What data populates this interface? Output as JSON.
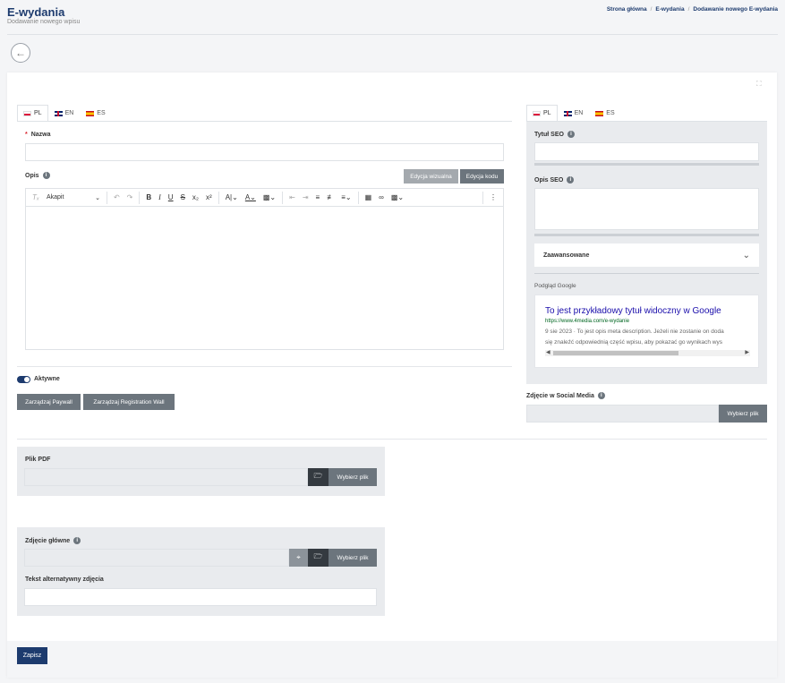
{
  "header": {
    "title": "E-wydania",
    "subtitle": "Dodawanie nowego wpisu",
    "breadcrumb": [
      "Strona główna",
      "E-wydania",
      "Dodawanie nowego E-wydania"
    ]
  },
  "lang_tabs": [
    {
      "code": "pl",
      "label": "PL",
      "active": true
    },
    {
      "code": "en",
      "label": "EN",
      "active": false
    },
    {
      "code": "es",
      "label": "ES",
      "active": false
    }
  ],
  "form": {
    "name_label": "Nazwa",
    "name_required_mark": "*",
    "name_value": "",
    "desc_label": "Opis",
    "visual_edit_label": "Edycja wizualna",
    "code_edit_label": "Edycja kodu",
    "paragraph_style": "Akapit",
    "active_label": "Aktywne",
    "active": true,
    "paywall_button": "Zarządzaj Paywall",
    "registration_wall_button": "Zarządzaj Registration Wall"
  },
  "seo": {
    "title_label": "Tytuł SEO",
    "desc_label": "Opis SEO",
    "advanced_label": "Zaawansowane",
    "google_preview_label": "Podgląd Google",
    "google_title": "To jest przykładowy tytuł widoczny w Google",
    "google_url": "https://www.4media.com/e-wydanie",
    "google_date": "9 sie 2023",
    "google_desc_line1": "To jest opis meta description. Jeżeli nie zostanie on doda",
    "google_desc_line2": "się znaleźć odpowiednią część wpisu, aby pokazać go wynikach wys",
    "social_label": "Zdjęcie w Social Media",
    "social_choose": "Wybierz plik"
  },
  "pdf": {
    "label": "Plik PDF",
    "choose": "Wybierz plik"
  },
  "main_image": {
    "label": "Zdjęcie główne",
    "choose": "Wybierz plik",
    "alt_label": "Tekst alternatywny zdjęcia",
    "alt_value": ""
  },
  "footer": {
    "save_label": "Zapisz"
  },
  "colors": {
    "primary": "#1d3b6e",
    "secondary_button": "#6c757d",
    "required": "#d9232d",
    "google_title": "#1a0dab",
    "google_url": "#006621"
  }
}
